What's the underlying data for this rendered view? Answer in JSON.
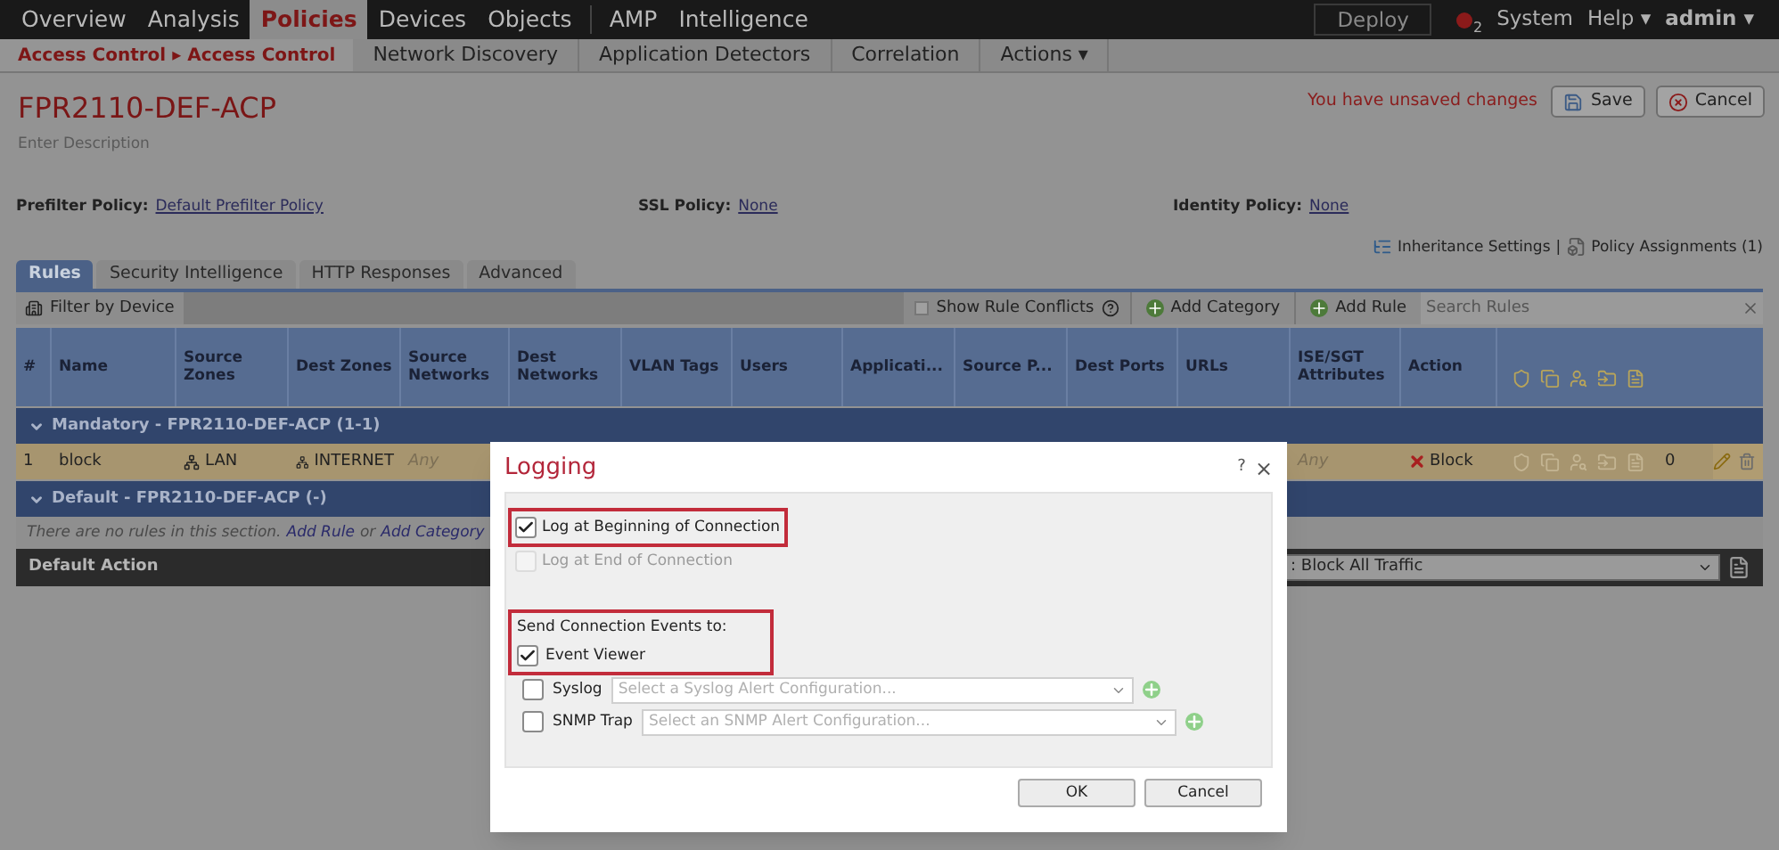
{
  "top_nav": {
    "items": [
      {
        "label": "Overview",
        "selected": false
      },
      {
        "label": "Analysis",
        "selected": false
      },
      {
        "label": "Policies",
        "selected": true
      },
      {
        "label": "Devices",
        "selected": false
      },
      {
        "label": "Objects",
        "selected": false
      },
      {
        "label": "AMP",
        "selected": false
      },
      {
        "label": "Intelligence",
        "selected": false
      }
    ],
    "deploy": "Deploy",
    "alert_count": "2",
    "system": "System",
    "help": "Help ▾",
    "user": "admin ▾"
  },
  "sub_nav": {
    "breadcrumb": "Access Control ▸ Access Control",
    "items": [
      "Network Discovery",
      "Application Detectors",
      "Correlation",
      "Actions ▾"
    ]
  },
  "policy": {
    "title": "FPR2110-DEF-ACP",
    "description": "Enter Description",
    "unsaved": "You have unsaved changes",
    "save": "Save",
    "cancel": "Cancel",
    "fields": [
      {
        "label": "Prefilter Policy:",
        "value": "Default Prefilter Policy"
      },
      {
        "label": "SSL Policy:",
        "value": "None"
      },
      {
        "label": "Identity Policy:",
        "value": "None"
      }
    ],
    "inheritance": "Inheritance Settings",
    "separator": "|",
    "assignments": "Policy Assignments (1)"
  },
  "tabs": [
    {
      "label": "Rules",
      "selected": true
    },
    {
      "label": "Security Intelligence",
      "selected": false
    },
    {
      "label": "HTTP Responses",
      "selected": false
    },
    {
      "label": "Advanced",
      "selected": false
    }
  ],
  "toolbar": {
    "filter": "Filter by Device",
    "show_conflicts": {
      "label": "Show Rule Conflicts",
      "checked": false
    },
    "add_category": "Add Category",
    "add_rule": "Add Rule",
    "search_placeholder": "Search Rules"
  },
  "table": {
    "columns": [
      "#",
      "Name",
      "Source Zones",
      "Dest Zones",
      "Source Networks",
      "Dest Networks",
      "VLAN Tags",
      "Users",
      "Applicati...",
      "Source P...",
      "Dest Ports",
      "URLs",
      "ISE/SGT Attributes",
      "Action"
    ],
    "sections": [
      {
        "title": "Mandatory - FPR2110-DEF-ACP (1-1)",
        "rows": [
          {
            "number": "1",
            "name": "block",
            "source_zones": "LAN",
            "dest_zones": "INTERNET",
            "source_networks": "Any",
            "ise_sgt": "Any",
            "action": "Block",
            "count": "0"
          }
        ]
      },
      {
        "title": "Default - FPR2110-DEF-ACP (-)",
        "empty_text": "There are no rules in this section.",
        "add_rule": "Add Rule",
        "or": "or",
        "add_category": "Add Category"
      }
    ],
    "default_action": {
      "label": "Default Action",
      "value": ": Block All Traffic"
    }
  },
  "dialog": {
    "title": "Logging",
    "help": "?",
    "close": "×",
    "log_options": [
      {
        "label": "Log at Beginning of Connection",
        "checked": true,
        "disabled": false,
        "highlighted": true
      },
      {
        "label": "Log at End of Connection",
        "checked": false,
        "disabled": true,
        "highlighted": false
      }
    ],
    "send_label": "Send Connection Events to:",
    "destinations_highlighted": true,
    "destinations": [
      {
        "kind": "plain",
        "label": "Event Viewer",
        "checked": true
      },
      {
        "kind": "select",
        "label": "Syslog",
        "checked": false,
        "placeholder": "Select a Syslog Alert Configuration..."
      },
      {
        "kind": "select",
        "label": "SNMP Trap",
        "checked": false,
        "placeholder": "Select an SNMP Alert Configuration..."
      }
    ],
    "buttons": [
      "OK",
      "Cancel"
    ]
  }
}
